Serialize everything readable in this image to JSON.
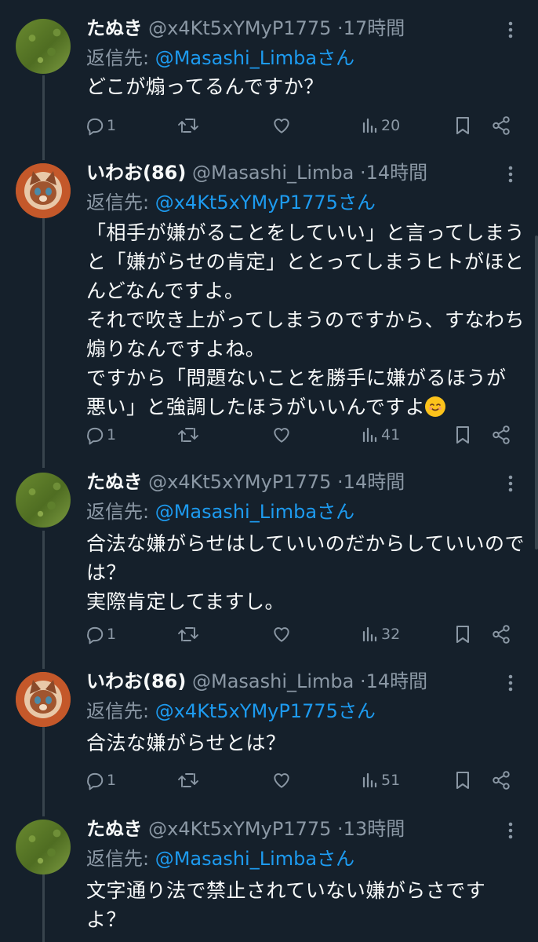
{
  "labels": {
    "reply_prefix": "返信先: ",
    "reply_suffix": "さん",
    "separator": "·"
  },
  "colors": {
    "background": "#15202b",
    "text": "#f7f9f9",
    "muted": "#8b98a5",
    "accent": "#1d9bf0"
  },
  "tweets": [
    {
      "name": "たぬき",
      "handle": "@x4Kt5xYMyP1775",
      "time": "17時間",
      "reply_to": "@Masashi_Limba",
      "text": "どこが煽ってるんですか？",
      "replies": "1",
      "views": "20",
      "avatar": "grass-avatar"
    },
    {
      "name": "いわお(86)",
      "handle": "@Masashi_Limba",
      "time": "14時間",
      "reply_to": "@x4Kt5xYMyP1775",
      "text": "「相手が嫌がることをしていい」と言ってしまうと「嫌がらせの肯定」ととってしまうヒトがほとんどなんですよ。\nそれで吹き上がってしまうのですから、すなわち煽りなんですよね。\nですから「問題ないことを勝手に嫌がるほうが悪い」と強調したほうがいいんですよ",
      "emoji": "smiling-face-emoji",
      "replies": "1",
      "views": "41",
      "avatar": "cat-avatar"
    },
    {
      "name": "たぬき",
      "handle": "@x4Kt5xYMyP1775",
      "time": "14時間",
      "reply_to": "@Masashi_Limba",
      "text": "合法な嫌がらせはしていいのだからしていいのでは？\n実際肯定してますし。",
      "replies": "1",
      "views": "32",
      "avatar": "grass-avatar"
    },
    {
      "name": "いわお(86)",
      "handle": "@Masashi_Limba",
      "time": "14時間",
      "reply_to": "@x4Kt5xYMyP1775",
      "text": "合法な嫌がらせとは？",
      "replies": "1",
      "views": "51",
      "avatar": "cat-avatar"
    },
    {
      "name": "たぬき",
      "handle": "@x4Kt5xYMyP1775",
      "time": "13時間",
      "reply_to": "@Masashi_Limba",
      "text": "文字通り法で禁止されていない嫌がらさですよ？",
      "avatar": "grass-avatar"
    }
  ],
  "icons": [
    "reply-icon",
    "retweet-icon",
    "like-icon",
    "views-icon",
    "bookmark-icon",
    "share-icon",
    "more-icon"
  ]
}
